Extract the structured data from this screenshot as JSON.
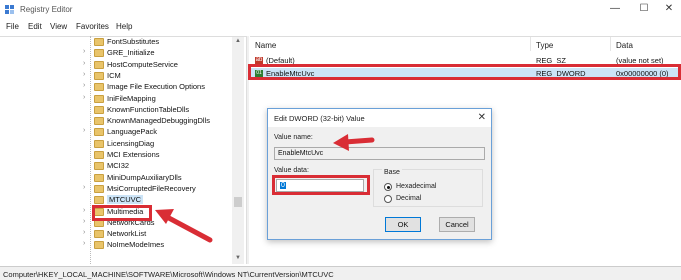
{
  "window": {
    "title": "Registry Editor",
    "minimize": "—",
    "maximize": "☐",
    "close": "✕"
  },
  "menu": [
    "File",
    "Edit",
    "View",
    "Favorites",
    "Help"
  ],
  "tree": {
    "items": [
      {
        "label": "FontSubstitutes",
        "expandable": false
      },
      {
        "label": "GRE_Initialize",
        "expandable": true
      },
      {
        "label": "HostComputeService",
        "expandable": true
      },
      {
        "label": "ICM",
        "expandable": true
      },
      {
        "label": "Image File Execution Options",
        "expandable": true
      },
      {
        "label": "IniFileMapping",
        "expandable": true
      },
      {
        "label": "KnownFunctionTableDlls",
        "expandable": false
      },
      {
        "label": "KnownManagedDebuggingDlls",
        "expandable": false
      },
      {
        "label": "LanguagePack",
        "expandable": true
      },
      {
        "label": "LicensingDiag",
        "expandable": false
      },
      {
        "label": "MCI Extensions",
        "expandable": false
      },
      {
        "label": "MCI32",
        "expandable": false
      },
      {
        "label": "MiniDumpAuxiliaryDlls",
        "expandable": false
      },
      {
        "label": "MsiCorruptedFileRecovery",
        "expandable": true
      },
      {
        "label": "MTCUVC",
        "expandable": false,
        "selected": true
      },
      {
        "label": "Multimedia",
        "expandable": true
      },
      {
        "label": "NetworkCards",
        "expandable": true
      },
      {
        "label": "NetworkList",
        "expandable": true
      },
      {
        "label": "NoImeModeImes",
        "expandable": true
      }
    ]
  },
  "list": {
    "columns": [
      "Name",
      "Type",
      "Data"
    ],
    "rows": [
      {
        "icon": "ab",
        "name": "(Default)",
        "type": "REG_SZ",
        "data": "(value not set)"
      },
      {
        "icon": "binary",
        "name": "EnableMtcUvc",
        "type": "REG_DWORD",
        "data": "0x00000000 (0)",
        "selected": true
      }
    ]
  },
  "status": {
    "path": "Computer\\HKEY_LOCAL_MACHINE\\SOFTWARE\\Microsoft\\Windows NT\\CurrentVersion\\MTCUVC"
  },
  "dialog": {
    "title": "Edit DWORD (32-bit) Value",
    "close": "✕",
    "value_name_label": "Value name:",
    "value_name": "EnableMtcUvc",
    "value_data_label": "Value data:",
    "value_data": "0",
    "base_label": "Base",
    "hex_label": "Hexadecimal",
    "dec_label": "Decimal",
    "base_selected": "Hexadecimal",
    "ok_label": "OK",
    "cancel_label": "Cancel"
  },
  "colors": {
    "highlight": "#d92d35",
    "selection": "#cce4f7",
    "accent": "#0078d7"
  }
}
